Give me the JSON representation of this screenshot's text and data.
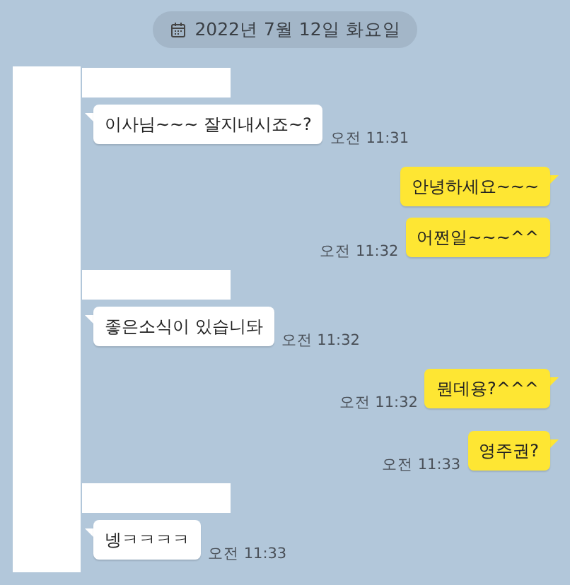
{
  "date_divider": {
    "text": "2022년 7월 12일 화요일"
  },
  "messages": [
    {
      "kind": "received",
      "text": "이사님~~~ 잘지내시죠~?",
      "time": "오전 11:31",
      "tail": true
    },
    {
      "kind": "sent",
      "text": "안녕하세요~~~",
      "tail": true
    },
    {
      "kind": "sent",
      "text": "어쩐일~~~^^",
      "time": "오전 11:32",
      "tail": false
    },
    {
      "kind": "received",
      "text": "좋은소식이 있습니돠",
      "time": "오전 11:32",
      "tail": true
    },
    {
      "kind": "sent",
      "text": "뭔데용?^^^",
      "time": "오전 11:32",
      "tail": true
    },
    {
      "kind": "sent",
      "text": "영주권?",
      "time": "오전 11:33",
      "tail": true
    },
    {
      "kind": "received",
      "text": "넹ㅋㅋㅋㅋ",
      "time": "오전 11:33",
      "tail": true
    }
  ]
}
